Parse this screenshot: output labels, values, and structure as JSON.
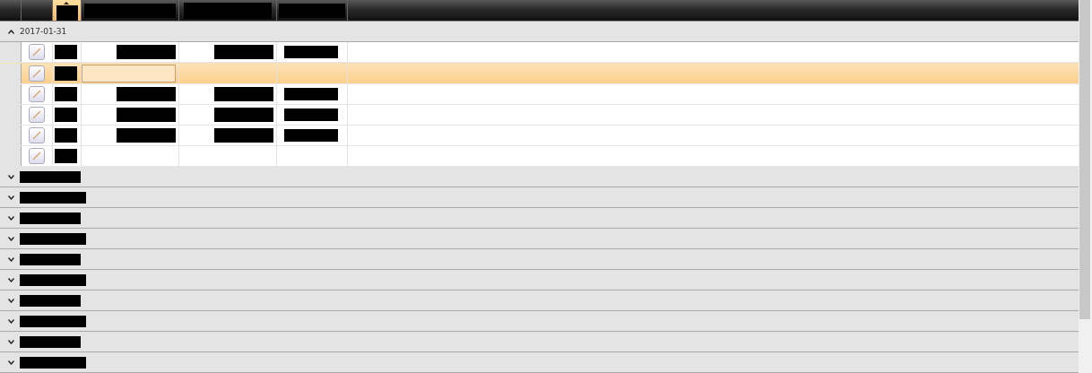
{
  "columns": [
    {
      "redacted": false,
      "sorted": false
    },
    {
      "redacted": false,
      "sorted": false
    },
    {
      "redacted": true,
      "sorted": true
    },
    {
      "redacted": true,
      "sorted": false
    },
    {
      "redacted": true,
      "sorted": false
    },
    {
      "redacted": true,
      "sorted": false
    }
  ],
  "groups": [
    {
      "label": "2017-01-31",
      "redacted": false,
      "expanded": true,
      "rows": [
        {
          "selected": false,
          "cells": [
            {
              "redacted": true,
              "editing": false
            },
            {
              "redacted": true,
              "editing": false
            },
            {
              "redacted": true,
              "editing": false
            },
            {
              "redacted": true,
              "editing": false
            }
          ]
        },
        {
          "selected": true,
          "cells": [
            {
              "redacted": true,
              "editing": false
            },
            {
              "redacted": false,
              "editing": true
            },
            {
              "redacted": false,
              "editing": false
            },
            {
              "redacted": false,
              "editing": false
            }
          ]
        },
        {
          "selected": false,
          "cells": [
            {
              "redacted": true,
              "editing": false
            },
            {
              "redacted": true,
              "editing": false
            },
            {
              "redacted": true,
              "editing": false
            },
            {
              "redacted": true,
              "editing": false
            }
          ]
        },
        {
          "selected": false,
          "cells": [
            {
              "redacted": true,
              "editing": false
            },
            {
              "redacted": true,
              "editing": false
            },
            {
              "redacted": true,
              "editing": false
            },
            {
              "redacted": true,
              "editing": false
            }
          ]
        },
        {
          "selected": false,
          "cells": [
            {
              "redacted": true,
              "editing": false
            },
            {
              "redacted": true,
              "editing": false
            },
            {
              "redacted": true,
              "editing": false
            },
            {
              "redacted": true,
              "editing": false
            }
          ]
        },
        {
          "selected": false,
          "cells": [
            {
              "redacted": true,
              "editing": false
            },
            {
              "redacted": false,
              "editing": false
            },
            {
              "redacted": false,
              "editing": false
            },
            {
              "redacted": false,
              "editing": false
            }
          ]
        }
      ]
    },
    {
      "redacted": true,
      "expanded": false
    },
    {
      "redacted": true,
      "expanded": false
    },
    {
      "redacted": true,
      "expanded": false
    },
    {
      "redacted": true,
      "expanded": false
    },
    {
      "redacted": true,
      "expanded": false
    },
    {
      "redacted": true,
      "expanded": false
    },
    {
      "redacted": true,
      "expanded": false
    },
    {
      "redacted": true,
      "expanded": false
    },
    {
      "redacted": true,
      "expanded": false
    },
    {
      "redacted": true,
      "expanded": false
    }
  ]
}
